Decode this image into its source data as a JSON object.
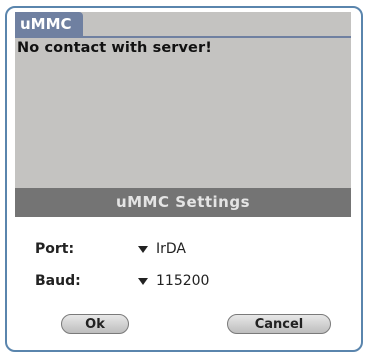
{
  "app": {
    "title": "uMMC"
  },
  "main": {
    "message": "No contact with server!"
  },
  "dialog": {
    "title": "uMMC Settings",
    "port": {
      "label": "Port:",
      "value": "IrDA"
    },
    "baud": {
      "label": "Baud:",
      "value": "115200"
    },
    "ok_label": "Ok",
    "cancel_label": "Cancel"
  },
  "colors": {
    "title_bar": "#6f80a1",
    "background": "#c4c3c1",
    "dialog_header": "#747474",
    "frame": "#5a85ad"
  }
}
